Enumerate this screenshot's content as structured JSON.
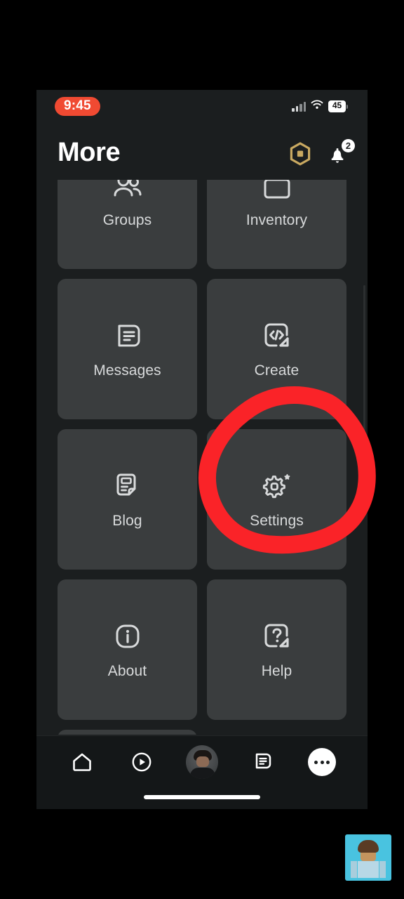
{
  "status_bar": {
    "time": "9:45",
    "battery_level": "45",
    "signal_icon": "cellular-signal-icon",
    "wifi_icon": "wifi-icon",
    "battery_icon": "battery-icon",
    "recording_pill_color": "#f04a32"
  },
  "header": {
    "title": "More",
    "robux_icon": "robux-hexagon-icon",
    "notifications_icon": "bell-icon",
    "notifications_badge": "2"
  },
  "grid": {
    "tiles": [
      {
        "label": "Groups",
        "icon": "groups-icon",
        "clipped": true
      },
      {
        "label": "Inventory",
        "icon": "inventory-icon",
        "clipped": true
      },
      {
        "label": "Messages",
        "icon": "message-document-icon"
      },
      {
        "label": "Create",
        "icon": "code-external-link-icon"
      },
      {
        "label": "Blog",
        "icon": "blog-document-icon"
      },
      {
        "label": "Settings",
        "icon": "gear-icon",
        "highlighted": true
      },
      {
        "label": "About",
        "icon": "info-icon"
      },
      {
        "label": "Help",
        "icon": "question-external-link-icon"
      },
      {
        "label": "",
        "icon": "",
        "clipped": true
      }
    ]
  },
  "bottom_nav": {
    "items": [
      {
        "name": "home",
        "icon": "home-icon",
        "active": false
      },
      {
        "name": "charts",
        "icon": "play-circle-icon",
        "active": false
      },
      {
        "name": "avatar",
        "icon": "avatar-icon",
        "active": false
      },
      {
        "name": "chat",
        "icon": "chat-icon",
        "active": false
      },
      {
        "name": "more",
        "icon": "more-dots-icon",
        "active": true
      }
    ]
  },
  "annotation": {
    "type": "hand-drawn-circle",
    "color": "#fa2328",
    "target": "Settings"
  },
  "floating_thumbnail": {
    "label": "roblox-avatar-thumbnail",
    "background_color": "#49c3e0"
  },
  "colors": {
    "page_background": "#1b1e1f",
    "tile_background": "#3a3d3e",
    "nav_background": "#141718",
    "text_primary": "#ffffff",
    "text_secondary": "#d8dadb",
    "accent_red": "#fa2328",
    "robux_gold": "#c9a961"
  }
}
